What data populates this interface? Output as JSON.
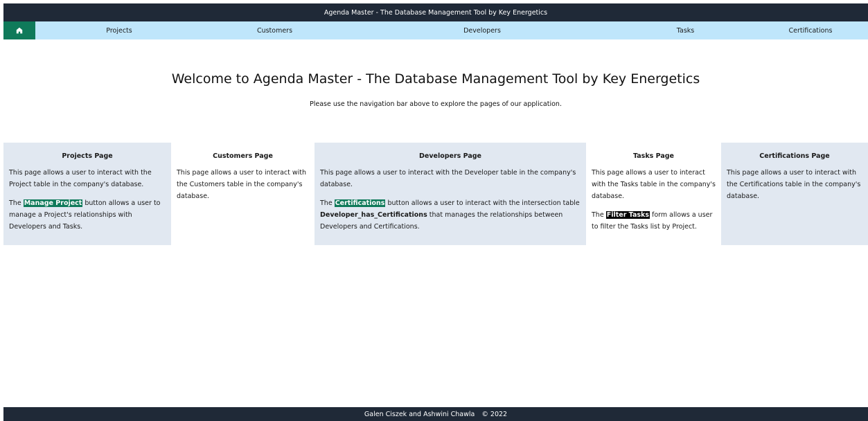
{
  "app": {
    "title": "Agenda Master - The Database Management Tool by Key Energetics"
  },
  "nav": {
    "home_icon": "home-icon",
    "items": [
      {
        "label": "Projects"
      },
      {
        "label": "Customers"
      },
      {
        "label": "Developers"
      },
      {
        "label": "Tasks"
      },
      {
        "label": "Certifications"
      }
    ]
  },
  "hero": {
    "title": "Welcome to Agenda Master - The Database Management Tool by Key Energetics",
    "subtitle": "Please use the navigation bar above to explore the pages of our application."
  },
  "cards": {
    "projects": {
      "title": "Projects Page",
      "p1": "This page allows a user to interact with the Project table in the company's database.",
      "p2_pre": "The ",
      "p2_button": "Manage Project",
      "p2_post": " button allows a user to manage a Project's relationships with Developers and Tasks."
    },
    "customers": {
      "title": "Customers Page",
      "p1": "This page allows a user to interact with the Customers table in the company's database."
    },
    "developers": {
      "title": "Developers Page",
      "p1": "This page allows a user to interact with the Developer table in the company's database.",
      "p2_pre": "The ",
      "p2_button": "Certifications",
      "p2_mid": " button allows a user to interact with the intersection table ",
      "p2_bold": "Developer_has_Certifications",
      "p2_post": " that manages the relationships between Developers and Certifications."
    },
    "tasks": {
      "title": "Tasks Page",
      "p1": "This page allows a user to interact with the Tasks table in the company's database.",
      "p2_pre": "The ",
      "p2_button": "Filter Tasks",
      "p2_post": " form allows a user to filter the Tasks list by Project."
    },
    "certifications": {
      "title": "Certifications Page",
      "p1": "This page allows a user to interact with the Certifications table in the company's database."
    }
  },
  "footer": {
    "authors": "Galen Ciszek and Ashwini Chawla",
    "copyright": "© 2022"
  },
  "colors": {
    "topbar": "#1f2937",
    "nav": "#bfe6fb",
    "accent": "#0f7a5a",
    "card": "#e1e8f1"
  }
}
